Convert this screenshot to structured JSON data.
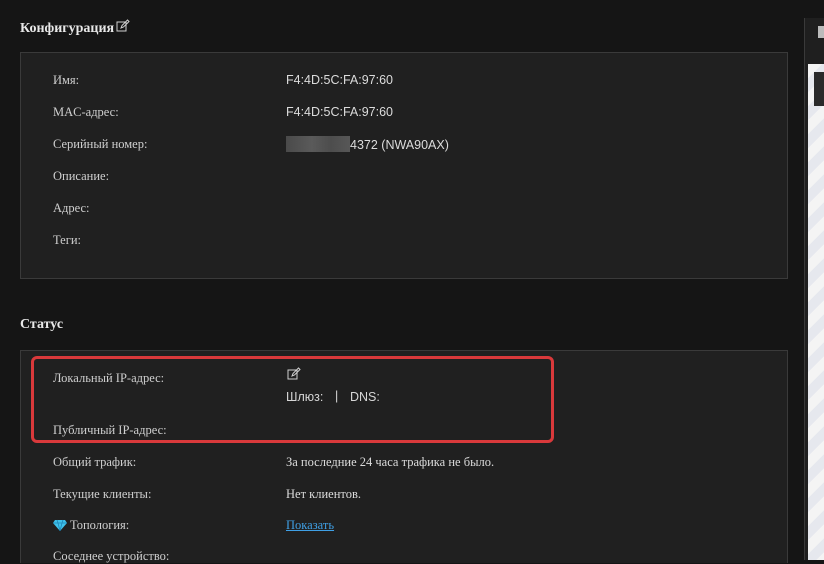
{
  "config": {
    "title": "Конфигурация",
    "rows": [
      {
        "label": "Имя:",
        "value": "F4:4D:5C:FA:97:60"
      },
      {
        "label": "MAC-адрес:",
        "value": "F4:4D:5C:FA:97:60"
      },
      {
        "label": "Серийный номер:",
        "value": "4372 (NWA90AX)"
      },
      {
        "label": "Описание:",
        "value": ""
      },
      {
        "label": "Адрес:",
        "value": ""
      },
      {
        "label": "Теги:",
        "value": ""
      }
    ]
  },
  "status": {
    "title": "Статус",
    "local_ip_label": "Локальный IP-адрес:",
    "gateway_label": "Шлюз:",
    "separator": "|",
    "dns_label": "DNS:",
    "public_ip_label": "Публичный IP-адрес:",
    "traffic_label": "Общий трафик:",
    "traffic_value": "За последние 24 часа трафика не было.",
    "clients_label": "Текущие клиенты:",
    "clients_value": "Нет клиентов.",
    "topology_label": "Топология:",
    "topology_link": "Показать",
    "neighbor_label": "Соседнее устройство:"
  },
  "colors": {
    "background": "#151515",
    "panel": "#202020",
    "highlight": "#d9393b",
    "link": "#3fa0e6",
    "gem": "#3fc1ea"
  },
  "icons": [
    "edit-icon",
    "diamond-icon"
  ]
}
